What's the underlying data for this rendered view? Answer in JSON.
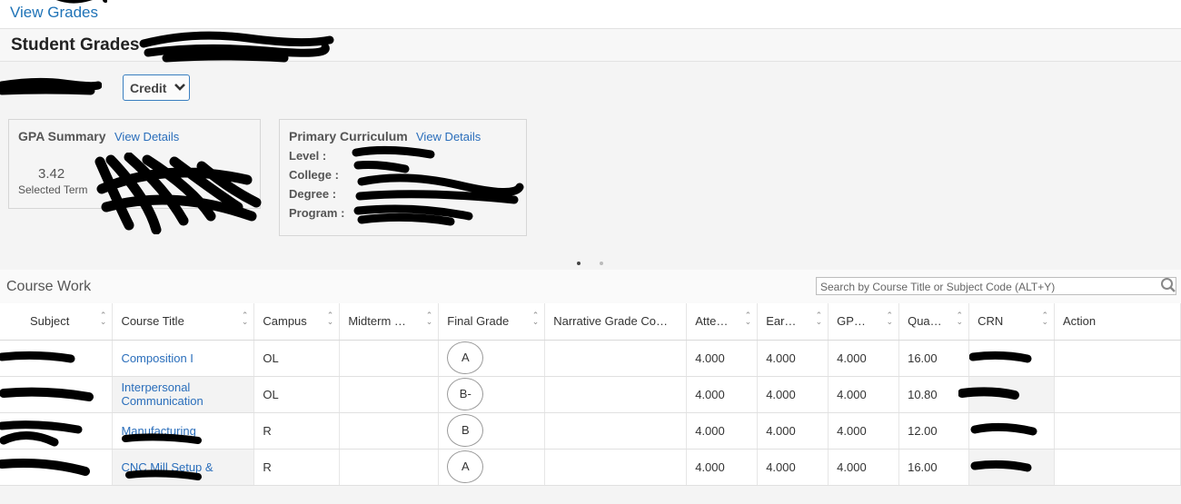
{
  "nav": {
    "view_grades": "View Grades"
  },
  "header": {
    "title": "Student Grades -"
  },
  "term_select": {
    "value": "Credit"
  },
  "gpa_summary": {
    "title": "GPA Summary",
    "link": "View Details",
    "value": "3.42",
    "label": "Selected Term"
  },
  "curriculum": {
    "title": "Primary Curriculum",
    "link": "View Details",
    "labels": [
      "Level :",
      "College :",
      "Degree :",
      "Program :"
    ]
  },
  "course_work": {
    "title": "Course Work",
    "search_placeholder": "Search by Course Title or Subject Code (ALT+Y)",
    "columns": [
      "Subject",
      "Course Title",
      "Campus",
      "Midterm …",
      "Final Grade",
      "Narrative Grade Co…",
      "Atte…",
      "Ear…",
      "GP…",
      "Qua…",
      "CRN",
      "Action"
    ],
    "rows": [
      {
        "title": "Composition I",
        "campus": "OL",
        "midterm": "",
        "final": "A",
        "narrative": "",
        "attempted": "4.000",
        "earned": "4.000",
        "gpa": "4.000",
        "quality": "16.00"
      },
      {
        "title": "Interpersonal Communication",
        "campus": "OL",
        "midterm": "",
        "final": "B-",
        "narrative": "",
        "attempted": "4.000",
        "earned": "4.000",
        "gpa": "4.000",
        "quality": "10.80"
      },
      {
        "title": "Manufacturing",
        "campus": "R",
        "midterm": "",
        "final": "B",
        "narrative": "",
        "attempted": "4.000",
        "earned": "4.000",
        "gpa": "4.000",
        "quality": "12.00"
      },
      {
        "title": "CNC Mill Setup &",
        "campus": "R",
        "midterm": "",
        "final": "A",
        "narrative": "",
        "attempted": "4.000",
        "earned": "4.000",
        "gpa": "4.000",
        "quality": "16.00"
      }
    ]
  },
  "colors": {
    "link": "#2a6ebb",
    "accent": "#1f73b7",
    "redaction": "#000000"
  }
}
